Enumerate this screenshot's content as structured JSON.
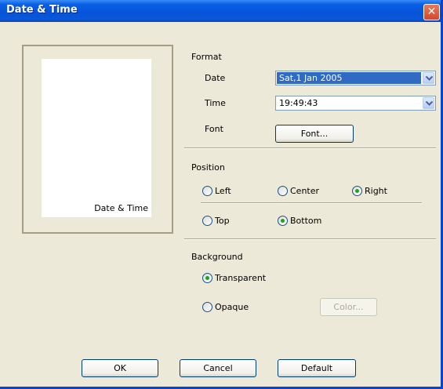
{
  "title": "Date & Time",
  "close_glyph": "✕",
  "preview": {
    "label": "Date & Time"
  },
  "format": {
    "heading": "Format",
    "date_label": "Date",
    "date_value": "Sat,1 Jan 2005",
    "time_label": "Time",
    "time_value": "19:49:43",
    "font_label": "Font",
    "font_button": "Font..."
  },
  "position": {
    "heading": "Position",
    "horizontal": [
      {
        "label": "Left",
        "selected": false
      },
      {
        "label": "Center",
        "selected": false
      },
      {
        "label": "Right",
        "selected": true
      }
    ],
    "vertical": [
      {
        "label": "Top",
        "selected": false
      },
      {
        "label": "Bottom",
        "selected": true
      }
    ]
  },
  "background": {
    "heading": "Background",
    "options": [
      {
        "label": "Transparent",
        "selected": true
      },
      {
        "label": "Opaque",
        "selected": false
      }
    ],
    "color_button": "Color..."
  },
  "footer": {
    "ok": "OK",
    "cancel": "Cancel",
    "default": "Default"
  },
  "colors": {
    "title_bar": "#0653d8",
    "window_bg": "#ece9d8",
    "selection": "#316ac5",
    "radio_dot": "#21a121",
    "close_button": "#d2492a"
  },
  "icons": {
    "combo_arrow": "chevron-down-icon",
    "radio_checked": "radio-dot-icon"
  }
}
